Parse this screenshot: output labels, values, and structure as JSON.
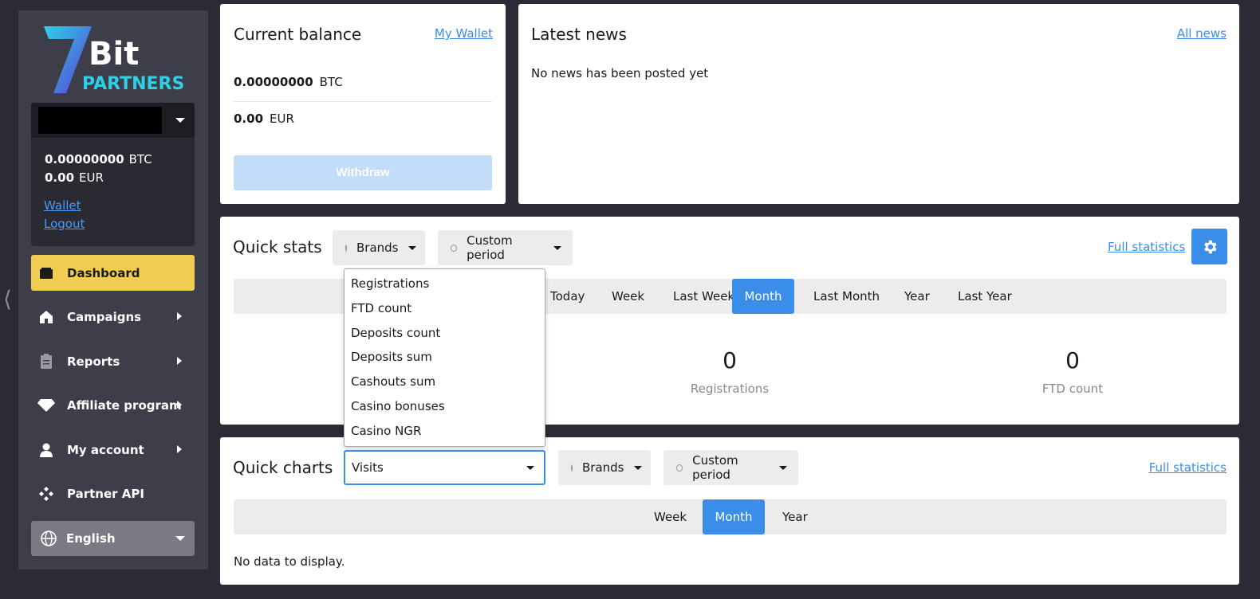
{
  "sidebar": {
    "logo": {
      "text_top": "Bit",
      "text_bottom": "PARTNERS",
      "digit": "7"
    },
    "account": {
      "btc_amount": "0.00000000",
      "btc_currency": "BTC",
      "eur_amount": "0.00",
      "eur_currency": "EUR",
      "wallet_link": "Wallet",
      "logout_link": "Logout"
    },
    "nav": [
      {
        "label": "Dashboard"
      },
      {
        "label": "Campaigns"
      },
      {
        "label": "Reports"
      },
      {
        "label": "Affiliate program"
      },
      {
        "label": "My account"
      },
      {
        "label": "Partner API"
      }
    ],
    "language": "English"
  },
  "balance": {
    "title": "Current balance",
    "wallet_link": "My Wallet",
    "btc_amount": "0.00000000",
    "btc_currency": "BTC",
    "eur_amount": "0.00",
    "eur_currency": "EUR",
    "withdraw": "Withdraw"
  },
  "news": {
    "title": "Latest news",
    "all_link": "All news",
    "empty": "No news has been posted yet"
  },
  "quick_stats": {
    "title": "Quick stats",
    "brands": "Brands",
    "period": "Custom period",
    "full_link": "Full statistics",
    "periods": [
      "Today",
      "Week",
      "Last Week",
      "Month",
      "Last Month",
      "Year",
      "Last Year"
    ],
    "active_period": "Month",
    "stats": [
      {
        "value": "0",
        "label": "Registrations"
      },
      {
        "value": "0",
        "label": "FTD count"
      }
    ],
    "dropdown_options": [
      "Registrations",
      "FTD count",
      "Deposits count",
      "Deposits sum",
      "Cashouts sum",
      "Casino bonuses",
      "Casino NGR"
    ]
  },
  "quick_charts": {
    "title": "Quick charts",
    "metric": "Visits",
    "brands": "Brands",
    "period": "Custom period",
    "full_link": "Full statistics",
    "periods": [
      "Week",
      "Month",
      "Year"
    ],
    "active_period": "Month",
    "empty": "No data to display."
  },
  "colors": {
    "accent": "#3a8de9",
    "active_nav": "#f0cc50",
    "sidebar_bg": "#3e3e4a",
    "page_bg": "#2b2b36"
  }
}
